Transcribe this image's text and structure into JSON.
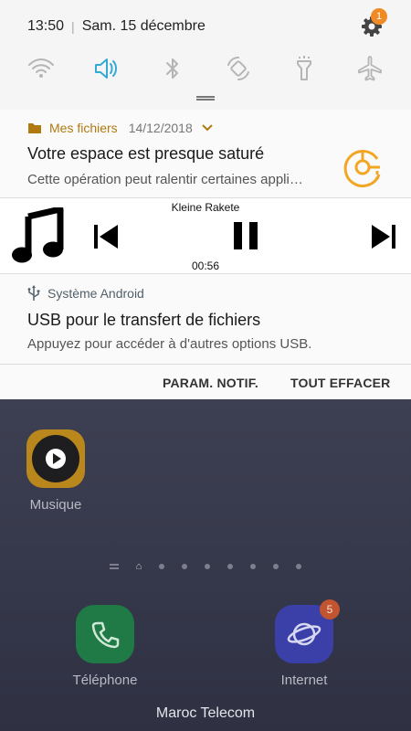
{
  "status_bar": {
    "time": "13:50",
    "separator": "|",
    "date": "Sam. 15 décembre",
    "settings_badge": "1"
  },
  "quick_settings": [
    {
      "icon": "wifi-icon",
      "active": false
    },
    {
      "icon": "sound-icon",
      "active": true
    },
    {
      "icon": "bluetooth-icon",
      "active": false
    },
    {
      "icon": "auto-rotate-icon",
      "active": false
    },
    {
      "icon": "flashlight-icon",
      "active": false
    },
    {
      "icon": "airplane-mode-icon",
      "active": false
    }
  ],
  "notification_storage": {
    "app": "Mes fichiers",
    "date": "14/12/2018",
    "title": "Votre espace est presque saturé",
    "body": "Cette opération peut ralentir certaines appli…"
  },
  "media_player": {
    "track": "Kleine Rakete",
    "elapsed": "00:56"
  },
  "notification_usb": {
    "app": "Système Android",
    "title": "USB pour le transfert de fichiers",
    "body": "Appuyez pour accéder à d'autres options USB."
  },
  "actions": {
    "notif_settings": "PARAM. NOTIF.",
    "clear_all": "TOUT EFFACER"
  },
  "home": {
    "music_app_label": "Musique",
    "phone_label": "Téléphone",
    "internet_label": "Internet",
    "internet_badge": "5",
    "carrier": "Maroc Telecom"
  },
  "colors": {
    "accent_active": "#35a9d6",
    "files_accent": "#b07a10",
    "storage_warning": "#f2a623"
  }
}
